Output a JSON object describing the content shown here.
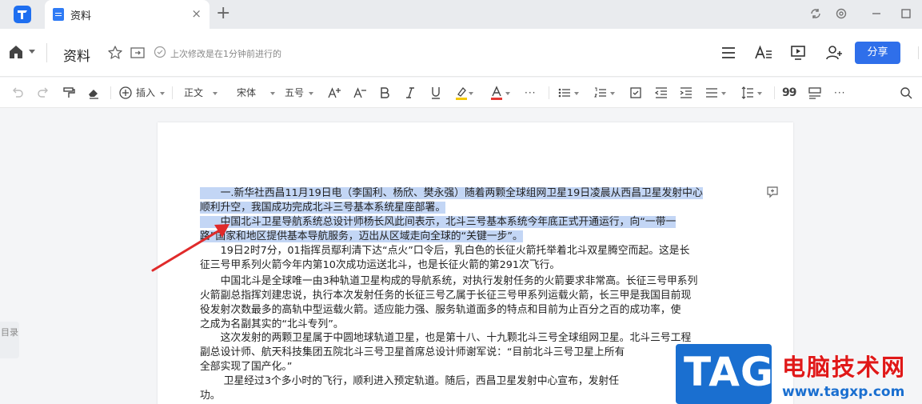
{
  "tab": {
    "title": "资料",
    "close": "×"
  },
  "tabbar": {
    "new_tab": "+"
  },
  "header": {
    "doc_title": "资料",
    "save_status": "上次修改是在1分钟前进行的",
    "share_label": "分享"
  },
  "toolbar": {
    "insert": "插入",
    "style": "正文",
    "font": "宋体",
    "size": "五号",
    "more": "···",
    "more2": "···",
    "quote": "99"
  },
  "sidebar": {
    "outline_label": "目录"
  },
  "document": {
    "paragraphs": [
      {
        "lines": [
          "　　一.新华社西昌11月19日电（李国利、杨欣、樊永强）随着两颗全球组网卫星19日凌晨从西昌卫星发射中心",
          "顺利升空，我国成功完成北斗三号基本系统星座部署。"
        ],
        "selected": true
      },
      {
        "lines": [
          "　　中国北斗卫星导航系统总设计师杨长风此间表示，北斗三号基本系统今年底正式开通运行，向“一带一",
          "路”国家和地区提供基本导航服务，迈出从区域走向全球的“关键一步”。"
        ],
        "selected": true
      },
      {
        "lines": [
          "　　19日2时7分，01指挥员鄢利清下达“点火”口令后，乳白色的长征火箭托举着北斗双星腾空而起。这是长",
          "征三号甲系列火箭今年内第10次成功运送北斗，也是长征火箭的第291次飞行。"
        ],
        "selected": false
      },
      {
        "lines": [
          "　　中国北斗是全球唯一由3种轨道卫星构成的导航系统，对执行发射任务的火箭要求非常高。长征三号甲系列",
          "火箭副总指挥刘建忠说，执行本次发射任务的长征三号乙属于长征三号甲系列运载火箭，长三甲是我国目前现",
          "役发射次数最多的高轨中型运载火箭。适应能力强、服务轨道面多的特点和目前为止百分之百的成功率，使",
          "之成为名副其实的“北斗专列”。"
        ],
        "selected": false
      },
      {
        "lines": [
          "　　这次发射的两颗卫星属于中圆地球轨道卫星，也是第十八、十九颗北斗三号全球组网卫星。北斗三号工程",
          "副总设计师、航天科技集团五院北斗三号卫星首席总设计师谢军说：“目前北斗三号卫星上所有",
          "全部实现了国产化。”"
        ],
        "selected": false
      },
      {
        "lines": [
          "　　 卫星经过3个多小时的飞行，顺利进入预定轨道。随后，西昌卫星发射中心宣布，发射任",
          "功。"
        ],
        "selected": false
      }
    ]
  },
  "watermark": {
    "tag": "TAG",
    "title": "电脑技术网",
    "url": "www.tagxp.com"
  },
  "colors": {
    "accent": "#2f6fea",
    "selection": "#c3d6f5",
    "arrow": "#e02a2a",
    "highlight_yellow": "#f5c800",
    "font_red": "#e53935"
  }
}
